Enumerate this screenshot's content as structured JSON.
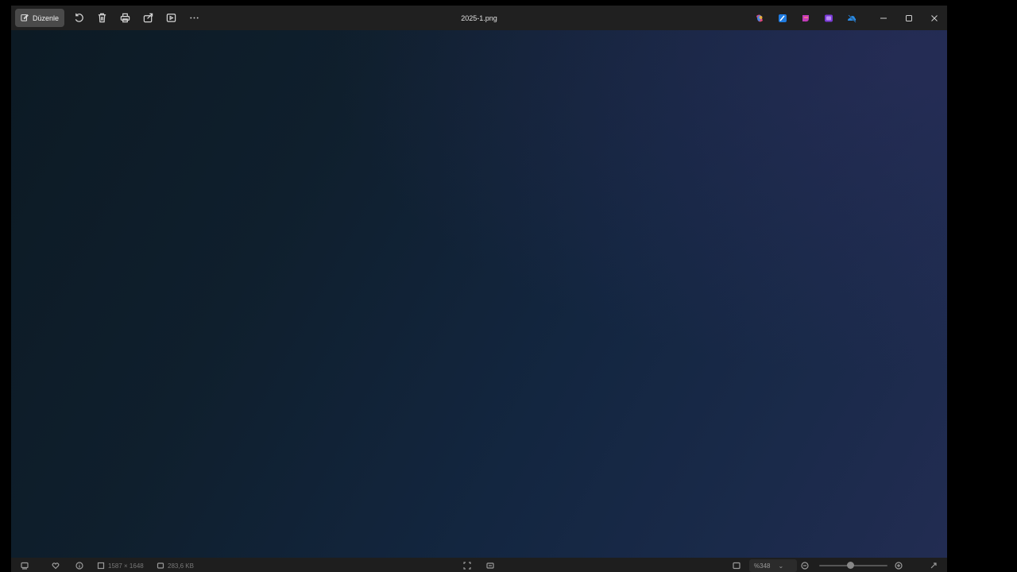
{
  "window": {
    "title": "2025-1.png"
  },
  "toolbar": {
    "edit_label": "Düzenle",
    "icons": [
      "edit-icon",
      "rotate-icon",
      "delete-icon",
      "print-icon",
      "share-icon",
      "slideshow-icon",
      "more-icon"
    ]
  },
  "app_icons": [
    "copilot-icon",
    "designer-icon",
    "clipchamp-icon",
    "create-icon",
    "onedrive-icon"
  ],
  "window_controls": [
    "minimize-icon",
    "maximize-icon",
    "close-icon"
  ],
  "statusbar": {
    "dimensions": "1587 × 1648",
    "file_size": "283,6 KB",
    "zoom": "%348",
    "zoom_level": 0.45
  },
  "colors": {
    "titlebar": "#202020",
    "edit_button": "#4a4a4a",
    "canvas_dark": "#0c1a24",
    "canvas_light": "#222c52"
  }
}
